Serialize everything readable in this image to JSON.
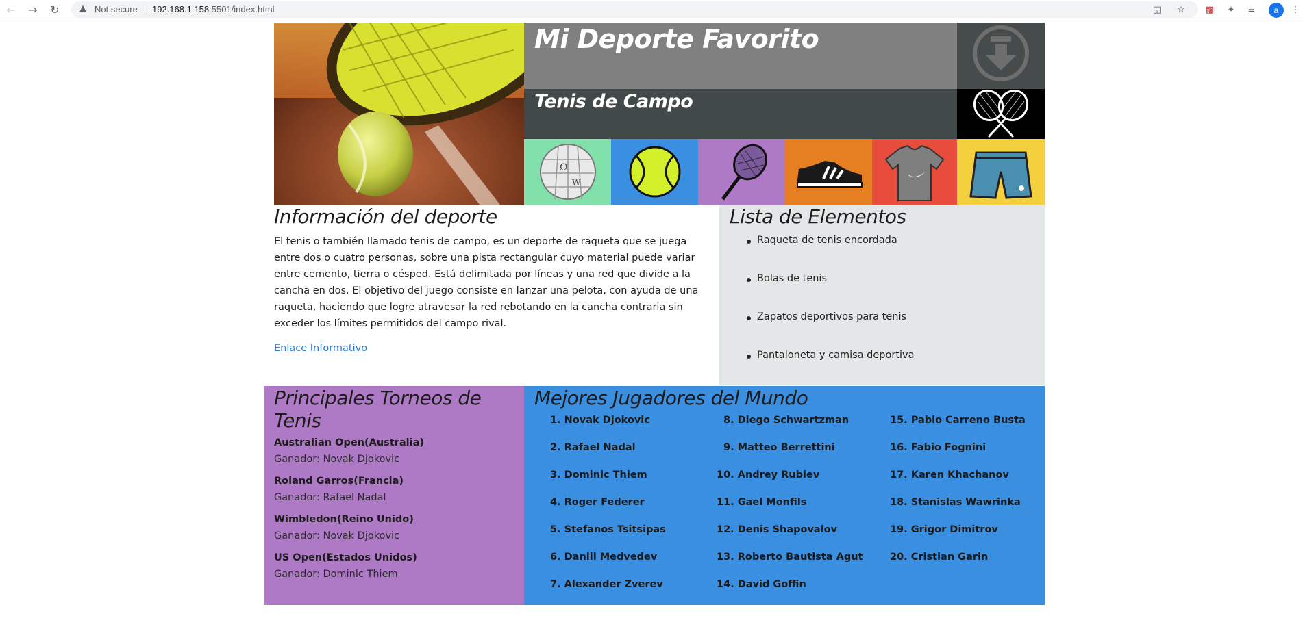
{
  "browser": {
    "security_label": "Not secure",
    "url_host": "192.168.1.158",
    "url_rest": ":5501/index.html",
    "avatar_letter": "a"
  },
  "header": {
    "title": "Mi Deporte Favorito",
    "subtitle": "Tenis de Campo"
  },
  "tiles": [
    {
      "name": "wikipedia",
      "color": "#82e0aa"
    },
    {
      "name": "tennis-ball",
      "color": "#3b8fe0"
    },
    {
      "name": "racket",
      "color": "#af7ac5"
    },
    {
      "name": "shoe",
      "color": "#e67e22"
    },
    {
      "name": "shirt",
      "color": "#e74c3c"
    },
    {
      "name": "shorts",
      "color": "#f4d03f"
    }
  ],
  "info": {
    "heading": "Información del deporte",
    "body": "El tenis o también llamado tenis de campo, es un deporte de raqueta que se juega entre dos o cuatro personas, sobre una pista rectangular cuyo material puede variar entre cemento, tierra o césped. Está delimitada por líneas y una red que divide a la cancha en dos. El objetivo del juego consiste en lanzar una pelota, con ayuda de una raqueta, haciendo que logre atravesar la red rebotando en la cancha contraria sin exceder los límites permitidos del campo rival.",
    "link": "Enlace Informativo"
  },
  "lista": {
    "heading": "Lista de Elementos",
    "items": [
      "Raqueta de tenis encordada",
      "Bolas de tenis",
      "Zapatos deportivos para tenis",
      "Pantaloneta y camisa deportiva"
    ]
  },
  "torneos": {
    "heading": "Principales Torneos de Tenis",
    "items": [
      {
        "name": "Australian Open(Australia)",
        "winner": "Ganador: Novak Djokovic"
      },
      {
        "name": "Roland Garros(Francia)",
        "winner": "Ganador: Rafael Nadal"
      },
      {
        "name": "Wimbledon(Reino Unido)",
        "winner": "Ganador: Novak Djokovic"
      },
      {
        "name": "US Open(Estados Unidos)",
        "winner": "Ganador: Dominic Thiem"
      }
    ]
  },
  "jugadores": {
    "heading": "Mejores Jugadores del Mundo",
    "items": [
      "1. Novak Djokovic",
      "2. Rafael Nadal",
      "3. Dominic Thiem",
      "4. Roger Federer",
      "5. Stefanos Tsitsipas",
      "6. Daniil Medvedev",
      "7. Alexander Zverev",
      "8. Diego Schwartzman",
      "9. Matteo Berrettini",
      "10. Andrey Rublev",
      "11. Gael Monfils",
      "12. Denis Shapovalov",
      "13. Roberto Bautista Agut",
      "14. David Goffin",
      "15. Pablo Carreno Busta",
      "16. Fabio Fognini",
      "17. Karen Khachanov",
      "18. Stanislas Wawrinka",
      "19. Grigor Dimitrov",
      "20. Cristian Garin"
    ]
  }
}
